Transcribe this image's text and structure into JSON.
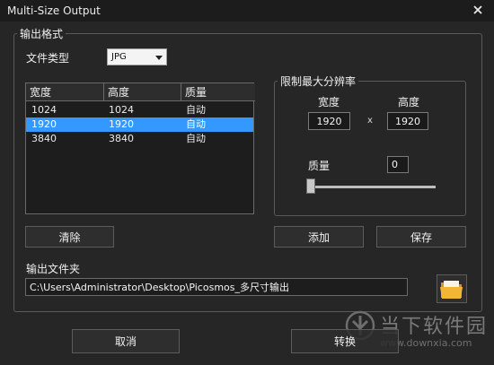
{
  "window": {
    "title": "Multi-Size Output"
  },
  "output_format": {
    "legend": "输出格式",
    "file_type_label": "文件类型",
    "file_type_value": "JPG",
    "columns": [
      "宽度",
      "高度",
      "质量"
    ],
    "rows": [
      {
        "width": "1024",
        "height": "1024",
        "quality": "自动",
        "selected": false
      },
      {
        "width": "1920",
        "height": "1920",
        "quality": "自动",
        "selected": true
      },
      {
        "width": "3840",
        "height": "3840",
        "quality": "自动",
        "selected": false
      }
    ],
    "clear_label": "清除"
  },
  "max_resolution": {
    "legend": "限制最大分辨率",
    "width_label": "宽度",
    "height_label": "高度",
    "width_value": "1920",
    "separator": "x",
    "height_value": "1920",
    "quality_label": "质量",
    "quality_value": "0",
    "quality_slider_level": 0,
    "add_label": "添加",
    "save_label": "保存"
  },
  "output_folder": {
    "label": "输出文件夹",
    "path": "C:\\Users\\Administrator\\Desktop\\Picosmos_多尺寸输出"
  },
  "footer": {
    "cancel_label": "取消",
    "convert_label": "转换"
  },
  "watermark": {
    "brand": "当下软件园",
    "url": "www.downxia.com"
  },
  "colors": {
    "selection": "#3399ff",
    "folder_icon": "#f2b634"
  }
}
